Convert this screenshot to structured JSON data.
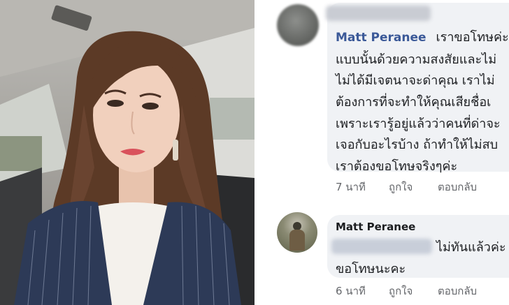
{
  "left_photo": {
    "description_icon": "portrait-photo"
  },
  "comments": [
    {
      "author": "Matt Peranee",
      "first_line_tail": "เราขอโทษค่ะที่",
      "lines": [
        "แบบนั้นด้วยความสงสัยและไม่",
        "ไม่ได้มีเจตนาจะด่าคุณ เราไม่",
        "ต้องการที่จะทำให้คุณเสียชื่อเ",
        "เพราะเรารู้อยู่แล้วว่าคนที่ด่าจะ",
        "เจอกับอะไรบ้าง ถ้าทำให้ไม่สบ",
        "เราต้องขอโทษจริงๆค่ะ"
      ],
      "time": "7 นาที",
      "like": "ถูกใจ",
      "reply": "ตอบกลับ"
    },
    {
      "author": "Matt Peranee",
      "first_line_tail": "ไม่ทันแล้วค่ะ",
      "lines": [
        "ขอโทษนะคะ"
      ],
      "time": "6 นาที",
      "like": "ถูกใจ",
      "reply": "ตอบกลับ"
    }
  ],
  "colors": {
    "author_blue": "#3b5998",
    "bubble_bg": "#f0f2f5",
    "meta_gray": "#65676b"
  }
}
